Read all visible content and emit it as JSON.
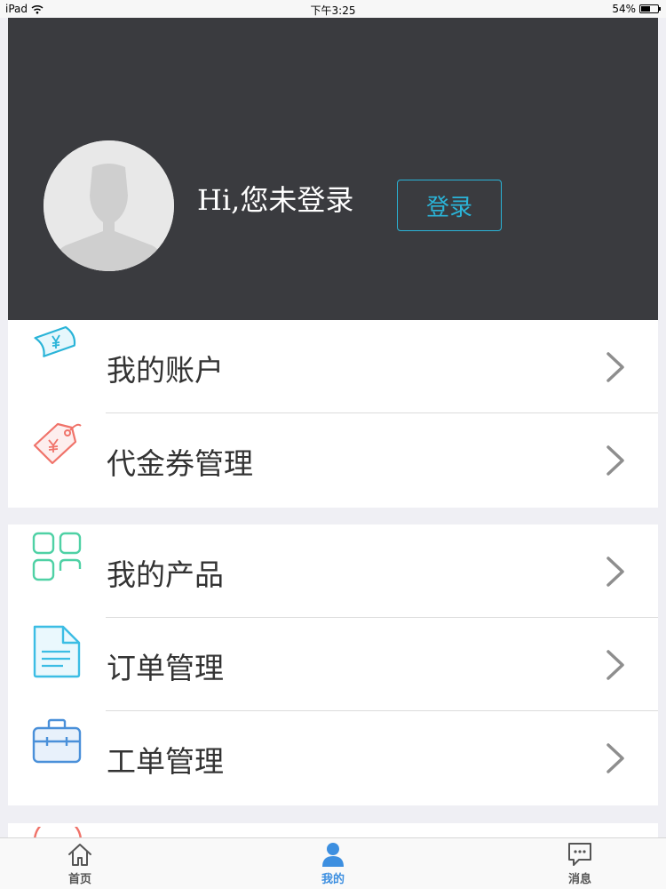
{
  "status_bar": {
    "device": "iPad",
    "time": "下午3:25",
    "battery": "54%",
    "battery_level": 0.54
  },
  "header": {
    "greeting": "Hi,您未登录",
    "login_label": "登录"
  },
  "menu": {
    "group1": [
      {
        "label": "我的账户",
        "icon": "banknote-yen-icon"
      },
      {
        "label": "代金券管理",
        "icon": "tag-yen-icon"
      }
    ],
    "group2": [
      {
        "label": "我的产品",
        "icon": "grid-icon"
      },
      {
        "label": "订单管理",
        "icon": "document-icon"
      },
      {
        "label": "工单管理",
        "icon": "briefcase-icon"
      }
    ]
  },
  "tabbar": {
    "items": [
      {
        "label": "首页",
        "icon": "home-icon",
        "active": false
      },
      {
        "label": "我的",
        "icon": "user-icon",
        "active": true
      },
      {
        "label": "消息",
        "icon": "message-icon",
        "active": false
      }
    ]
  },
  "colors": {
    "header_bg": "#3a3b3f",
    "accent": "#2ab4d8",
    "active_tab": "#3d8fe0"
  }
}
